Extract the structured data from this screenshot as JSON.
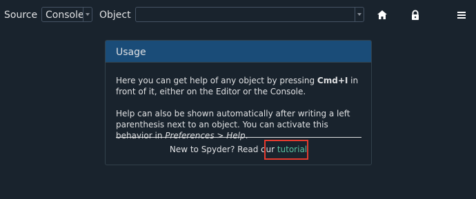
{
  "toolbar": {
    "source_label": "Source",
    "source_value": "Console",
    "object_label": "Object",
    "object_value": "",
    "icons": {
      "home": "home-icon",
      "lock": "lock-icon",
      "menu": "hamburger-menu-icon"
    }
  },
  "usage": {
    "title": "Usage",
    "p1_before": "Here you can get help of any object by pressing ",
    "p1_shortcut": "Cmd+I",
    "p1_after": " in front of it, either on the Editor or the Console.",
    "p2_text": "Help can also be shown automatically after writing a left parenthesis next to an object. You can activate this behavior in ",
    "p2_pref": "Preferences > Help",
    "p2_end": ".",
    "footer_text": "New to Spyder? Read our ",
    "footer_link": "tutorial"
  },
  "colors": {
    "background": "#19232d",
    "header": "#1a4c78",
    "link": "#58c2a1",
    "highlight": "#e53b2f",
    "text": "#e0e1e3"
  }
}
